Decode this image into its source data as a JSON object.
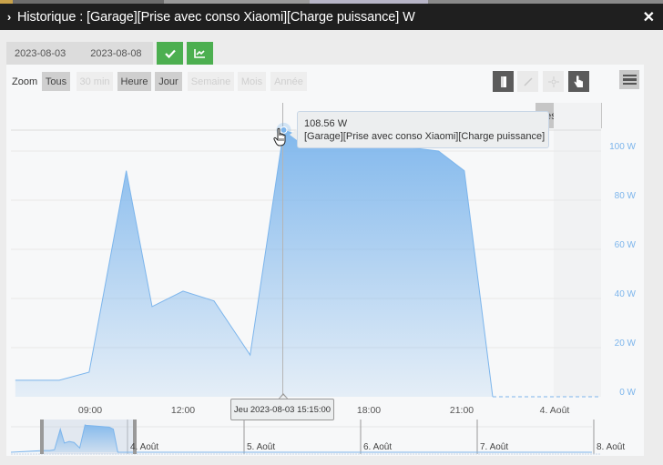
{
  "window": {
    "title": "Historique : [Garage][Prise avec conso Xiaomi][Charge puissance] W",
    "close_icon": "close-icon",
    "expand_icon": "chevron-right-icon"
  },
  "date_range": {
    "from": "2023-08-03",
    "to": "2023-08-08",
    "validate_icon": "check-icon",
    "compare_icon": "chart-icon"
  },
  "zoom": {
    "label": "Zoom",
    "buttons": [
      {
        "label": "Tous",
        "state": "active"
      },
      {
        "label": "30 min",
        "state": "disabled"
      },
      {
        "label": "Heure",
        "state": "active"
      },
      {
        "label": "Jour",
        "state": "active"
      },
      {
        "label": "Semaine",
        "state": "disabled"
      },
      {
        "label": "Mois",
        "state": "disabled"
      },
      {
        "label": "Année",
        "state": "disabled"
      }
    ]
  },
  "tools": [
    {
      "icon": "column-icon",
      "state": "active"
    },
    {
      "icon": "line-icon",
      "state": "disabled"
    },
    {
      "icon": "spline-icon",
      "state": "disabled"
    },
    {
      "icon": "pointer-icon",
      "state": "active"
    }
  ],
  "menu_icon": "hamburger-icon",
  "reset_zoom_label": "Reset zoom",
  "tooltip": {
    "value": "108.56 W",
    "series": "[Garage][Prise avec conso Xiaomi][Charge puissance]",
    "time": "Jeu 2023-08-03 15:15:00"
  },
  "colors": {
    "series": "#7cb5ec",
    "accent_green": "#4caf50",
    "axis_label": "#7cb5ec"
  },
  "chart_data": {
    "type": "area",
    "title": "",
    "xlabel": "",
    "ylabel": "",
    "series": [
      {
        "name": "[Garage][Prise avec conso Xiaomi][Charge puissance]",
        "unit": "W",
        "x": [
          "06:35",
          "08:00",
          "08:58",
          "10:10",
          "11:00",
          "12:00",
          "13:00",
          "14:10",
          "15:15",
          "15:30",
          "20:15",
          "21:05",
          "22:00",
          "01:30"
        ],
        "values": [
          6.7,
          6.7,
          10,
          92,
          36.7,
          43,
          39,
          17,
          108.56,
          107.4,
          100,
          92,
          0,
          0
        ]
      }
    ],
    "x_ticks": [
      "09:00",
      "12:00",
      "18:00",
      "21:00",
      "4. Août"
    ],
    "y_ticks": [
      "0 W",
      "20 W",
      "40 W",
      "60 W",
      "80 W",
      "100 W"
    ],
    "ylim": [
      0,
      100
    ],
    "y_axis_side": "right",
    "grid": true,
    "legend": "none",
    "navigator": {
      "labels": [
        "4. Août",
        "5. Août",
        "6. Août",
        "7. Août",
        "8. Août"
      ],
      "selected_range": [
        "2023-08-03 06:35",
        "2023-08-04 01:30"
      ]
    }
  }
}
